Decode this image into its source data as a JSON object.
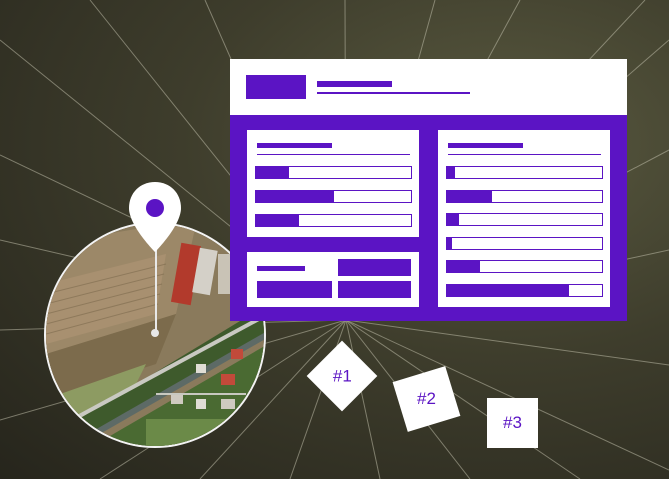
{
  "tags": [
    {
      "label": "#1"
    },
    {
      "label": "#2"
    },
    {
      "label": "#3"
    }
  ],
  "colors": {
    "accent": "#5b14c4",
    "panel_bg": "#ffffff",
    "background": "#3e3d2c"
  },
  "icons": {
    "pin": "location-pin-icon"
  },
  "form_left_bars": [
    0.21,
    0.5,
    0.28
  ],
  "form_right_bars": [
    0.05,
    0.29,
    0.08,
    0.03,
    0.21,
    0.79
  ]
}
